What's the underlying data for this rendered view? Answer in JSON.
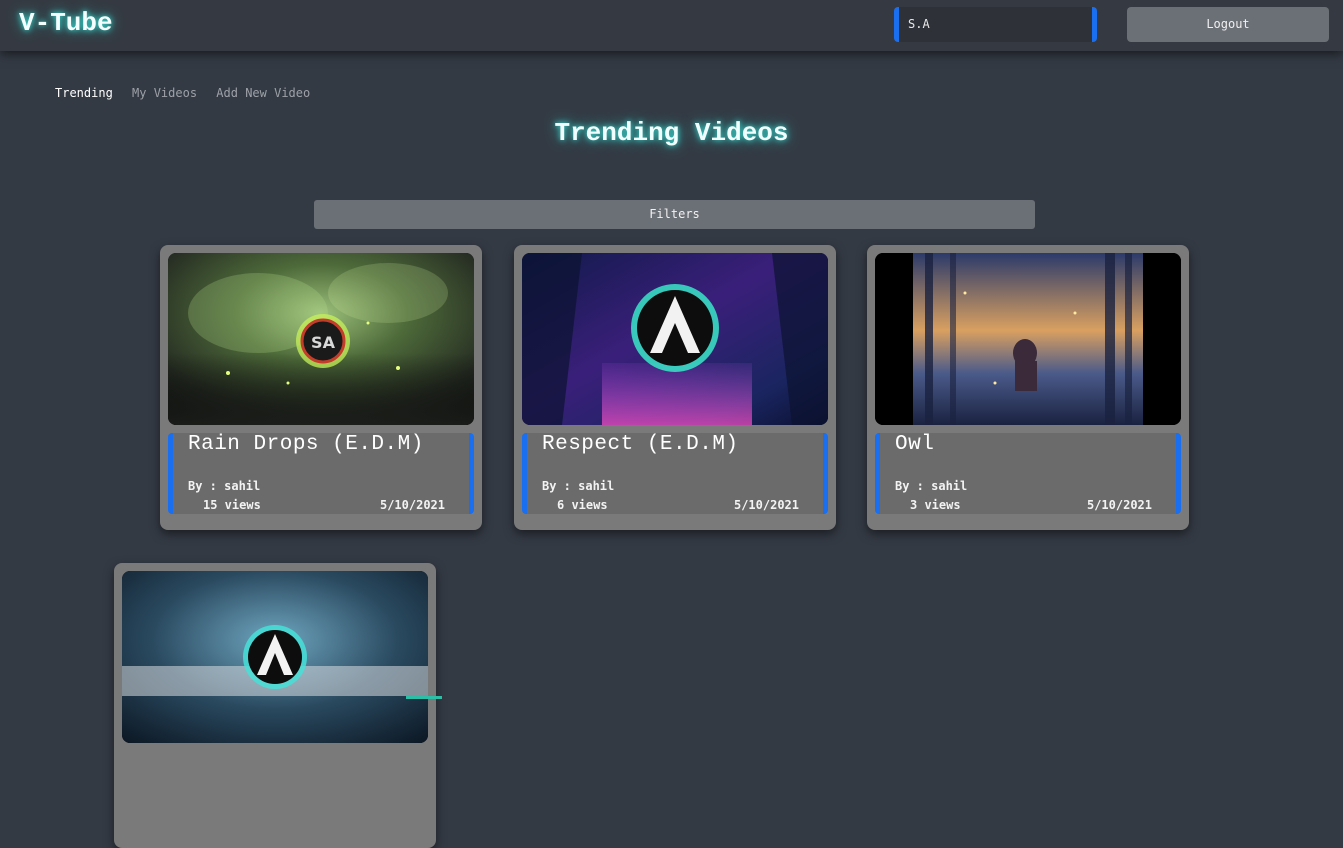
{
  "header": {
    "brand": "V-Tube",
    "username": "S.A",
    "logout_label": "Logout"
  },
  "nav": {
    "items": [
      {
        "label": "Trending",
        "active": true
      },
      {
        "label": "My Videos",
        "active": false
      },
      {
        "label": "Add New Video",
        "active": false
      }
    ]
  },
  "page": {
    "title": "Trending Videos",
    "filters_label": "Filters"
  },
  "videos": [
    {
      "title": "Rain Drops (E.D.M)",
      "author": "By : sahil",
      "views": "15 views",
      "date": "5/10/2021",
      "thumbnail": "green-rain-logo"
    },
    {
      "title": "Respect (E.D.M)",
      "author": "By : sahil",
      "views": "6 views",
      "date": "5/10/2021",
      "thumbnail": "neon-forest-logo"
    },
    {
      "title": "Owl",
      "author": "By : sahil",
      "views": "3 views",
      "date": "5/10/2021",
      "thumbnail": "forest-sunset-figure"
    },
    {
      "title": "",
      "author": "",
      "views": "",
      "date": "",
      "thumbnail": "blue-snow-logo"
    }
  ],
  "colors": {
    "accent_blue": "#1a6ff0",
    "glow_cyan": "#3ee0d6",
    "background": "#343a44"
  }
}
